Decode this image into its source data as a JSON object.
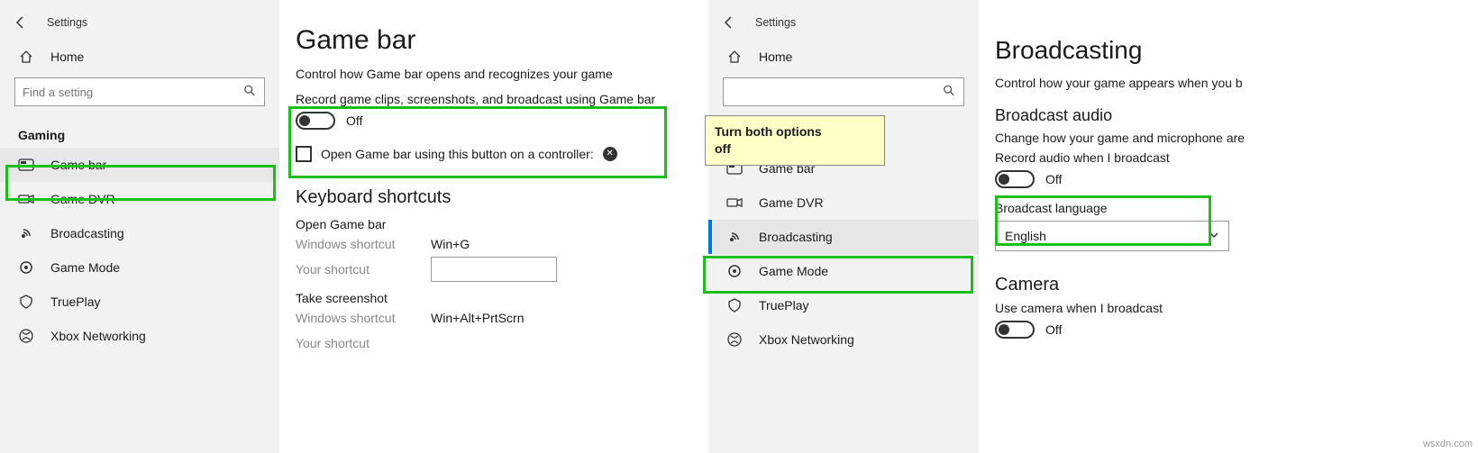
{
  "tooltip": "Turn both options\noff",
  "leftWindow": {
    "appTitle": "Settings",
    "home": "Home",
    "searchPlaceholder": "Find a setting",
    "sectionTitle": "Gaming",
    "nav": {
      "gamebar": "Game bar",
      "gamedvr": "Game DVR",
      "broadcasting": "Broadcasting",
      "gamemode": "Game Mode",
      "trueplay": "TruePlay",
      "xbox": "Xbox Networking"
    },
    "page": {
      "title": "Game bar",
      "subtitle": "Control how Game bar opens and recognizes your game",
      "toggleLabel": "Record game clips, screenshots, and broadcast using Game bar",
      "toggleState": "Off",
      "checkboxLabel": "Open Game bar using this button on a controller:",
      "kbHeader": "Keyboard shortcuts",
      "sc1": {
        "title": "Open Game bar",
        "winLabel": "Windows shortcut",
        "winValue": "Win+G",
        "yourLabel": "Your shortcut"
      },
      "sc2": {
        "title": "Take screenshot",
        "winLabel": "Windows shortcut",
        "winValue": "Win+Alt+PrtScrn",
        "yourLabel": "Your shortcut"
      }
    }
  },
  "rightWindow": {
    "appTitle": "Settings",
    "home": "Home",
    "nav": {
      "gamebar": "Game bar",
      "gamedvr": "Game DVR",
      "broadcasting": "Broadcasting",
      "gamemode": "Game Mode",
      "trueplay": "TruePlay",
      "xbox": "Xbox Networking"
    },
    "page": {
      "title": "Broadcasting",
      "subtitle": "Control how your game appears when you b",
      "audioHeader": "Broadcast audio",
      "audioDesc": "Change how your game and microphone are",
      "audioToggleLabel": "Record audio when I broadcast",
      "audioToggleState": "Off",
      "langLabel": "Broadcast language",
      "langValue": "English",
      "cameraHeader": "Camera",
      "cameraToggleLabel": "Use camera when I broadcast",
      "cameraToggleState": "Off"
    }
  },
  "credit": "wsxdn.com"
}
